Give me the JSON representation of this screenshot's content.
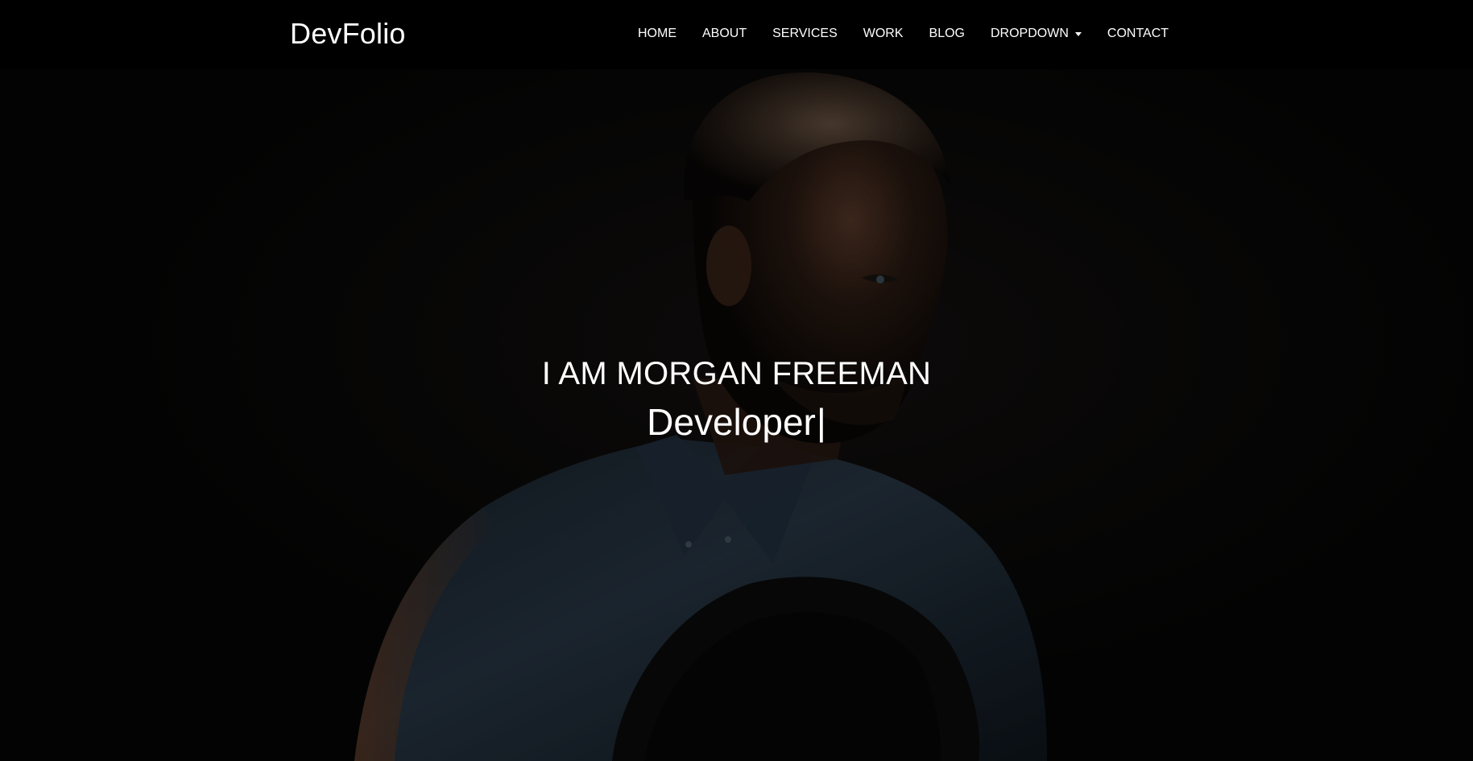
{
  "navbar": {
    "brand": "DevFolio",
    "items": [
      {
        "label": "HOME"
      },
      {
        "label": "ABOUT"
      },
      {
        "label": "SERVICES"
      },
      {
        "label": "WORK"
      },
      {
        "label": "BLOG"
      },
      {
        "label": "DROPDOWN",
        "icon": "caret-down-icon"
      },
      {
        "label": "CONTACT"
      }
    ]
  },
  "hero": {
    "title": "I AM MORGAN FREEMAN",
    "typed_text": "Developer",
    "cursor": "|"
  },
  "colors": {
    "background": "#050505",
    "navbar": "#000000",
    "text": "#ffffff"
  }
}
